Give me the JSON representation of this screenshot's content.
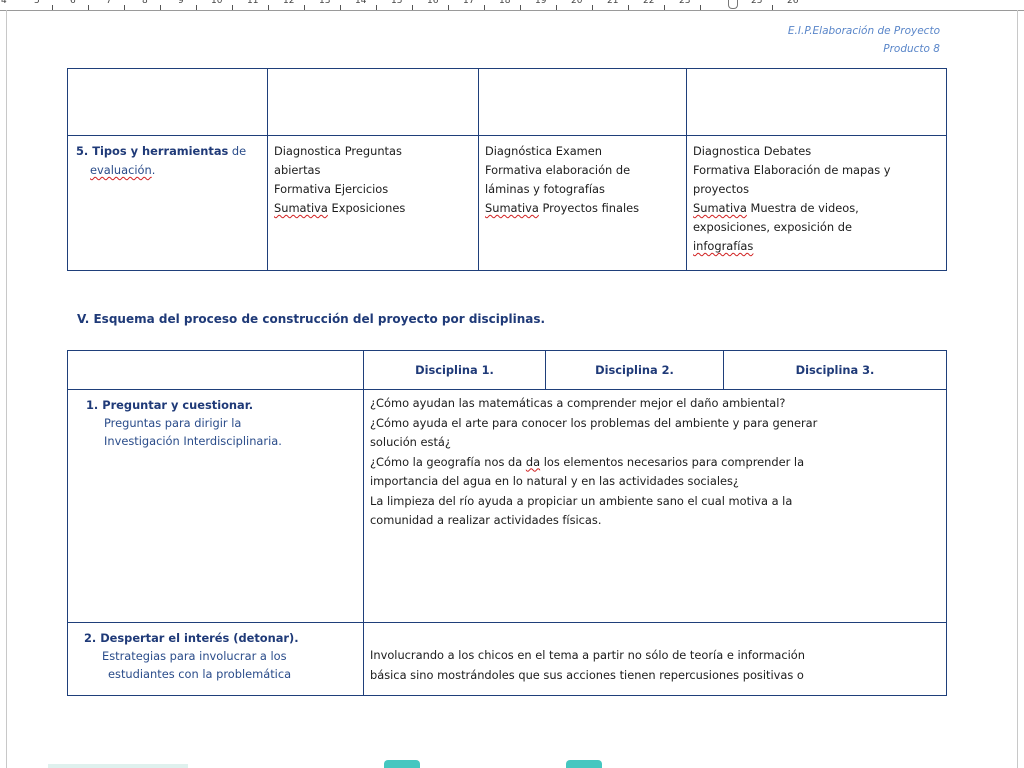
{
  "ruler": {
    "numbers": [
      "4",
      "5",
      "6",
      "7",
      "8",
      "9",
      "10",
      "11",
      "12",
      "13",
      "14",
      "15",
      "16",
      "17",
      "18",
      "19",
      "20",
      "21",
      "22",
      "23",
      "25",
      "26"
    ]
  },
  "header": {
    "line1": "E.I.P.Elaboración de Proyecto",
    "line2": "Producto 8"
  },
  "table1": {
    "row_label_title": "5. Tipos y herramientas",
    "row_label_de": "de",
    "row_label_sub": "evaluación",
    "row_label_dot": ".",
    "col1": {
      "l1": "Diagnostica  Preguntas",
      "l2": "abiertas",
      "l3": "Formativa Ejercicios",
      "l4a": "Sumativa",
      "l4b": "  Exposiciones"
    },
    "col2": {
      "l1": "Diagnóstica Examen",
      "l2": "Formativa elaboración de",
      "l3": "láminas y fotografías",
      "l4a": "Sumativa",
      "l4b": " Proyectos finales"
    },
    "col3": {
      "l1": "Diagnostica Debates",
      "l2": "Formativa  Elaboración de mapas y",
      "l3": "proyectos",
      "l4a": "Sumativa",
      "l4b": " Muestra de videos,",
      "l5": "exposiciones, exposición de",
      "l6": "infografías"
    }
  },
  "section_title": "V. Esquema  del proceso  de construcción  del proyecto por disciplinas.",
  "table2": {
    "headers": [
      "Disciplina  1.",
      "Disciplina  2.",
      "Disciplina  3."
    ],
    "q1": {
      "title": "1.  Preguntar y cuestionar.",
      "sub1": "Preguntas para dirigir  la",
      "sub2": "Investigación Interdisciplinaria.",
      "text1": "¿Cómo ayudan las matemáticas a comprender mejor el daño ambiental?",
      "text2": "¿Cómo ayuda  el arte para conocer los problemas del ambiente y para generar",
      "text3": "solución está¿",
      "text4a": "¿Cómo la geografía nos da ",
      "text4b": "da",
      "text4c": " los elementos necesarios para comprender la",
      "text5": "importancia del agua en lo natural y en las actividades sociales¿",
      "text6": "La limpieza del río ayuda  a propiciar un ambiente  sano el cual motiva a la",
      "text7": "comunidad a realizar actividades físicas."
    },
    "q2": {
      "title": "2. Despertar  el interés (detonar).",
      "sub1": "Estrategias para involucrar a los",
      "sub2": "estudiantes con la problemática",
      "text1": "Involucrando a los chicos en el tema  a partir no sólo de teoría e información",
      "text2": "básica sino mostrándoles que sus acciones tienen repercusiones positivas o"
    }
  }
}
